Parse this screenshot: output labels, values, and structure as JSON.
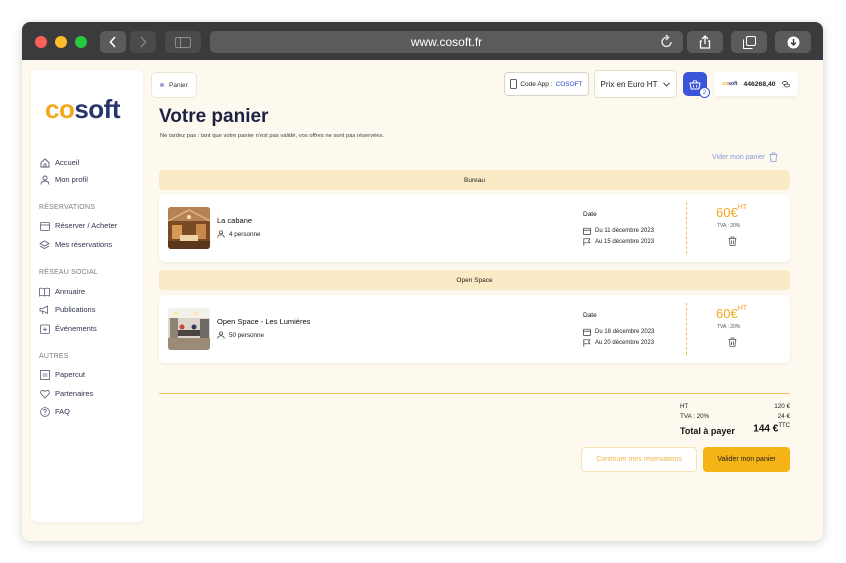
{
  "browser": {
    "url": "www.cosoft.fr"
  },
  "brand": {
    "logo_co": "co",
    "logo_soft": "soft",
    "primary_color": "#28356b",
    "accent_color": "#f2a81d",
    "action_color": "#3a55d9"
  },
  "sidebar": {
    "main": [
      {
        "label": "Accueil",
        "icon": "home-icon"
      },
      {
        "label": "Mon profil",
        "icon": "user-icon"
      }
    ],
    "sections": [
      {
        "title": "RÉSERVATIONS",
        "items": [
          {
            "label": "Réserver / Acheter",
            "icon": "calendar-icon"
          },
          {
            "label": "Mes réservations",
            "icon": "layers-icon"
          }
        ]
      },
      {
        "title": "RÉSEAU SOCIAL",
        "items": [
          {
            "label": "Annuaire",
            "icon": "book-icon"
          },
          {
            "label": "Publications",
            "icon": "megaphone-icon"
          },
          {
            "label": "Événements",
            "icon": "event-icon"
          }
        ]
      },
      {
        "title": "AUTRES",
        "items": [
          {
            "label": "Papercut",
            "icon": "printer-icon"
          },
          {
            "label": "Partenaires",
            "icon": "heart-icon"
          },
          {
            "label": "FAQ",
            "icon": "question-icon"
          }
        ]
      }
    ]
  },
  "header": {
    "breadcrumb": "Panier",
    "code_app_label": "Code App :",
    "code_app_brand": "COSOFT",
    "price_mode": "Prix en Euro HT",
    "basket_count": "2",
    "credits": "446268,40",
    "credits_logo": "cosoft"
  },
  "main": {
    "title": "Votre panier",
    "subtitle": "Ne tardez pas : tant que votre panier n'est pas validé, vos offres ne sont pas réservées.",
    "clear_cart": "Vider mon panier",
    "groups": [
      {
        "category": "Bureau",
        "item": {
          "name": "La cabane",
          "persons": "4 personne",
          "date_label": "Date",
          "date_from": "Du 11 décembre 2023",
          "date_to": "Au 15 décembre 2023",
          "price": "60",
          "currency": "€",
          "price_suffix": "HT",
          "tva": "TVA : 20%"
        }
      },
      {
        "category": "Open Space",
        "item": {
          "name": "Open Space - Les Lumières",
          "persons": "50 personne",
          "date_label": "Date",
          "date_from": "Du 18 décembre 2023",
          "date_to": "Au 20 décembre 2023",
          "price": "60",
          "currency": "€",
          "price_suffix": "HT",
          "tva": "TVA : 20%"
        }
      }
    ],
    "totals": {
      "ht_label": "HT",
      "ht_value": "120 €",
      "tva_label": "TVA : 20%",
      "tva_value": "24 €",
      "total_label": "Total à payer",
      "total_value": "144 €",
      "total_suffix": "TTC"
    },
    "actions": {
      "continue": "Continuer mes réservations",
      "validate": "Valider mon panier"
    }
  }
}
